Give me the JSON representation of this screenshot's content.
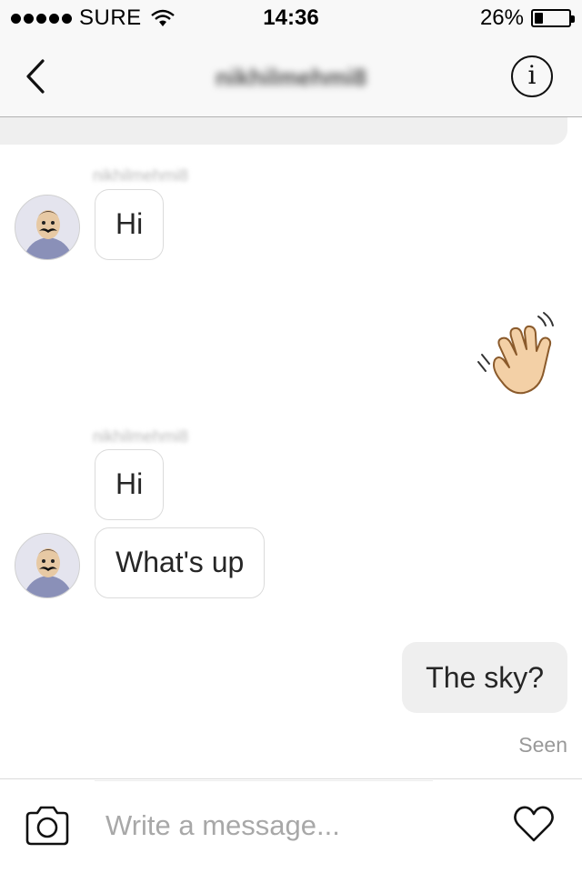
{
  "status_bar": {
    "carrier": "SURE",
    "time": "14:36",
    "battery_percent_label": "26%",
    "battery_level": 0.26
  },
  "nav": {
    "title": "nikhilmehmi8",
    "back_icon": "chevron-left-icon",
    "info_icon": "info-icon",
    "info_glyph": "i"
  },
  "messages": [
    {
      "sender": "nikhilmehmi8",
      "text": "Hi",
      "direction": "incoming"
    },
    {
      "type": "emoji",
      "icon": "waving-hand-icon",
      "direction": "outgoing"
    },
    {
      "sender": "nikhilmehmi8",
      "text": "Hi",
      "direction": "incoming"
    },
    {
      "text": "What's up",
      "direction": "incoming"
    },
    {
      "text": "The sky?",
      "direction": "outgoing"
    }
  ],
  "seen_label": "Seen",
  "composer": {
    "placeholder": "Write a message...",
    "camera_icon": "camera-icon",
    "heart_icon": "heart-icon"
  },
  "colors": {
    "bar_bg": "#f8f8f8",
    "outgoing_bubble": "#efefef",
    "incoming_border": "#dbdbdb",
    "muted_text": "#999999"
  }
}
